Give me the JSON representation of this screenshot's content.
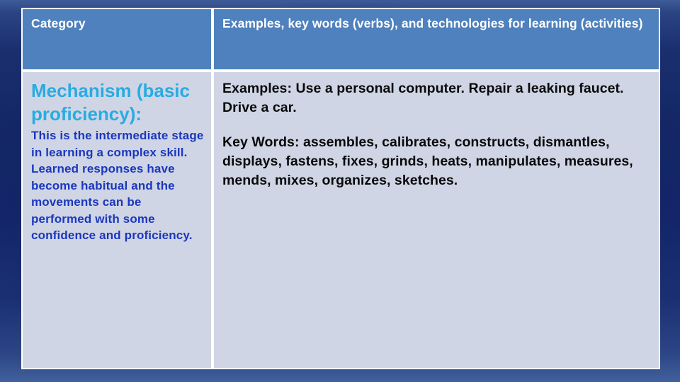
{
  "slide": {
    "background_top_color": "#3e5c98",
    "background_mid_color": "#142766",
    "background_bottom_color": "#41609c"
  },
  "table": {
    "header": {
      "col1": "Category",
      "col2": "Examples, key words (verbs), and technologies for learning (activities)",
      "background_color": "#4e81bd",
      "text_color": "#ffffff"
    },
    "rows": [
      {
        "category": {
          "title": "Mechanism (basic proficiency):",
          "title_color": "#29abe2",
          "description": "This is the intermediate stage in learning a complex skill. Learned responses have become habitual and the movements can be performed with some confidence and proficiency.",
          "description_color": "#1b37bd"
        },
        "examples": {
          "examples_line": "Examples:  Use a personal computer. Repair a leaking faucet. Drive a car.",
          "keywords_line": "Key Words: assembles, calibrates, constructs, dismantles, displays, fastens, fixes, grinds, heats, manipulates, measures, mends, mixes, organizes, sketches.",
          "text_color": "#0a0a0a",
          "background_color": "#cfd5e5"
        }
      }
    ]
  }
}
